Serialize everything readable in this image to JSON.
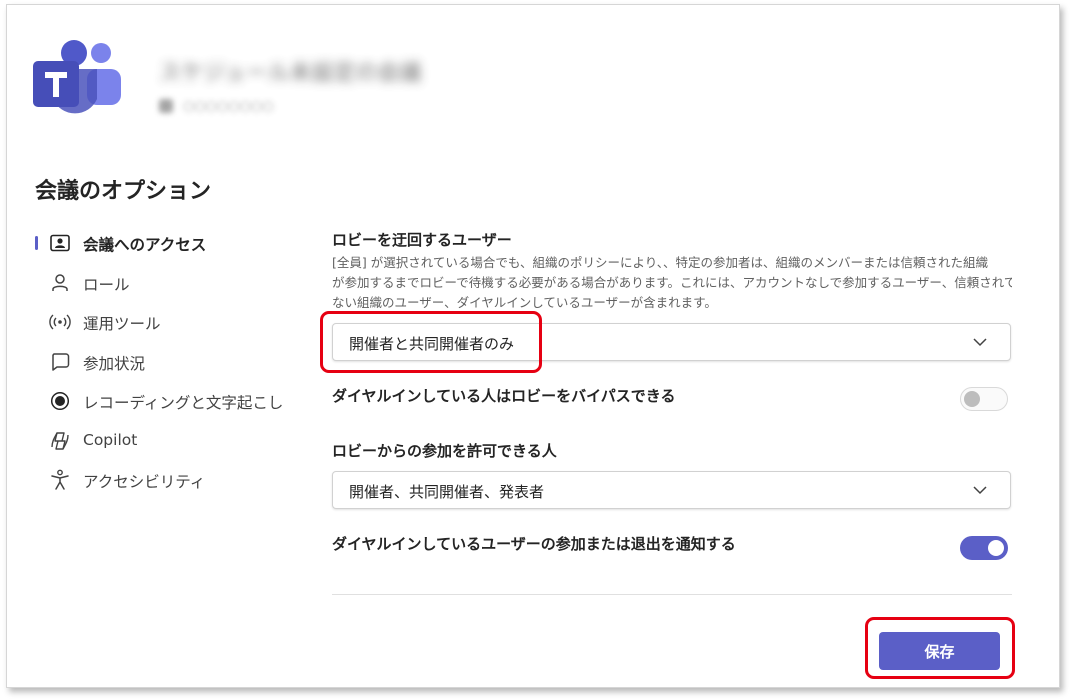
{
  "header": {
    "meeting_title": "スケジュール未設定の会議",
    "meeting_subtitle": "○○○○○○○○"
  },
  "page": {
    "title": "会議のオプション"
  },
  "nav": {
    "items": [
      {
        "label": "会議へのアクセス",
        "icon": "person-card-icon",
        "active": true
      },
      {
        "label": "ロール",
        "icon": "person-icon"
      },
      {
        "label": "運用ツール",
        "icon": "broadcast-icon"
      },
      {
        "label": "参加状況",
        "icon": "chat-bubble-icon"
      },
      {
        "label": "レコーディングと文字起こし",
        "icon": "record-icon"
      },
      {
        "label": "Copilot",
        "icon": "copilot-icon"
      },
      {
        "label": "アクセシビリティ",
        "icon": "accessibility-icon"
      }
    ]
  },
  "lobby_bypass": {
    "label": "ロビーを迂回するユーザー",
    "description_lines": [
      "[全員] が選択されている場合でも、組織のポリシーにより、、特定の参加者は、組織のメンバーまたは信頼された組織",
      "が参加するまでロビーで待機する必要がある場合があります。これには、アカウントなしで参加するユーザー、信頼されてい",
      "ない組織のユーザー、ダイヤルインしているユーザーが含まれます。"
    ],
    "selected": "開催者と共同開催者のみ"
  },
  "dialin_bypass": {
    "label": "ダイヤルインしている人はロビーをバイパスできる",
    "enabled": false
  },
  "admit_from_lobby": {
    "label": "ロビーからの参加を許可できる人",
    "selected": "開催者、共同開催者、発表者"
  },
  "dialin_notify": {
    "label": "ダイヤルインしているユーザーの参加または退出を通知する",
    "enabled": true
  },
  "actions": {
    "save_label": "保存"
  },
  "colors": {
    "accent": "#5b5fc7",
    "highlight": "#e60012"
  }
}
